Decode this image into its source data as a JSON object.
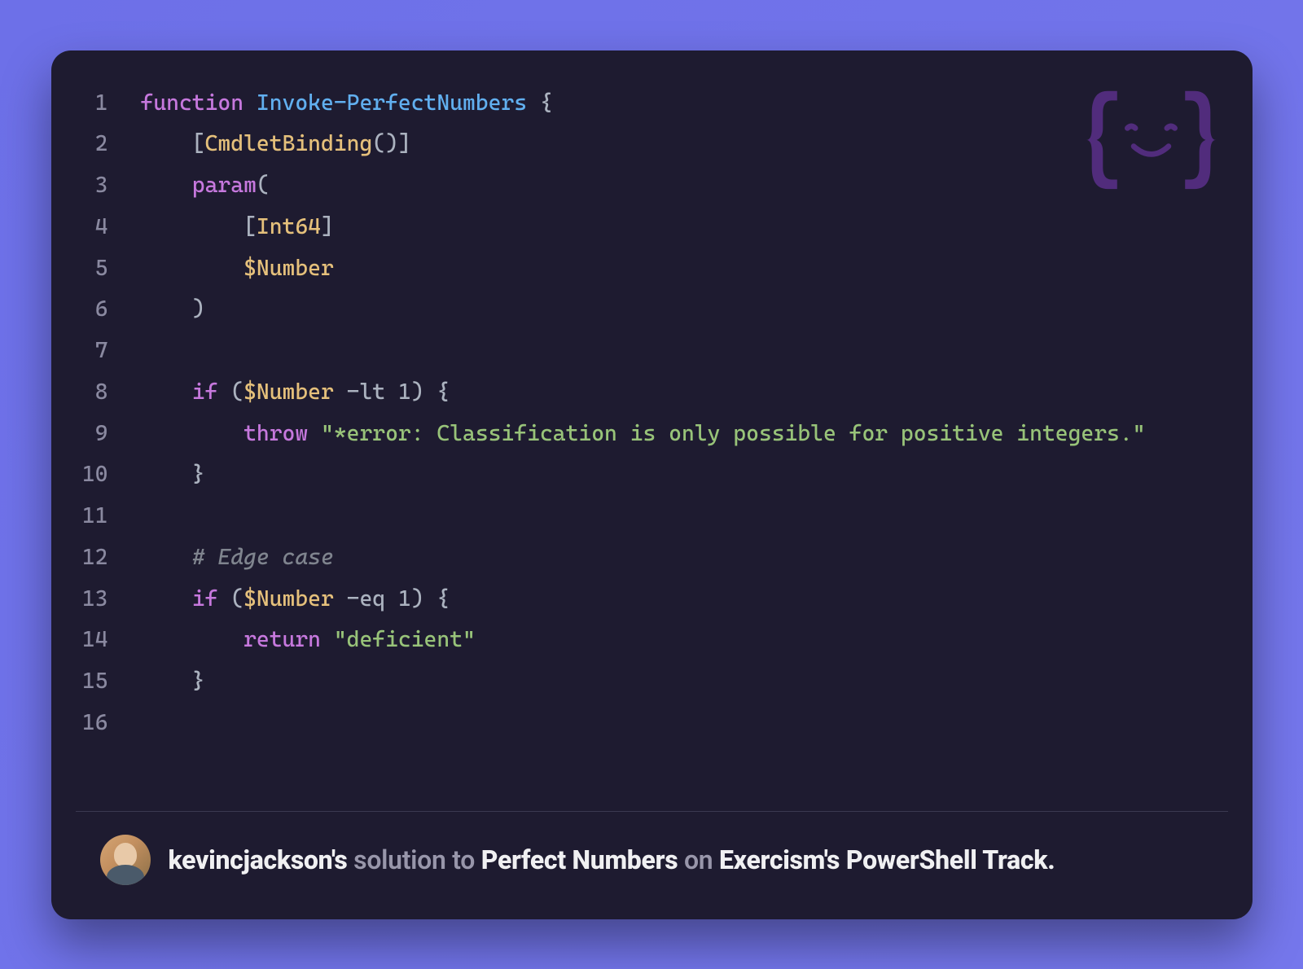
{
  "code": {
    "lines": [
      {
        "n": "1",
        "tokens": [
          {
            "t": "function",
            "c": "keyword"
          },
          {
            "t": " ",
            "c": "plain"
          },
          {
            "t": "Invoke-PerfectNumbers",
            "c": "func"
          },
          {
            "t": " {",
            "c": "punct"
          }
        ]
      },
      {
        "n": "2",
        "tokens": [
          {
            "t": "    [",
            "c": "punct"
          },
          {
            "t": "CmdletBinding",
            "c": "type"
          },
          {
            "t": "()]",
            "c": "punct"
          }
        ]
      },
      {
        "n": "3",
        "tokens": [
          {
            "t": "    ",
            "c": "plain"
          },
          {
            "t": "param",
            "c": "keyword"
          },
          {
            "t": "(",
            "c": "plain"
          }
        ]
      },
      {
        "n": "4",
        "tokens": [
          {
            "t": "        [",
            "c": "punct"
          },
          {
            "t": "Int64",
            "c": "type"
          },
          {
            "t": "]",
            "c": "punct"
          }
        ]
      },
      {
        "n": "5",
        "tokens": [
          {
            "t": "        ",
            "c": "plain"
          },
          {
            "t": "$Number",
            "c": "var"
          }
        ]
      },
      {
        "n": "6",
        "tokens": [
          {
            "t": "    )",
            "c": "plain"
          }
        ]
      },
      {
        "n": "7",
        "tokens": []
      },
      {
        "n": "8",
        "tokens": [
          {
            "t": "    ",
            "c": "plain"
          },
          {
            "t": "if",
            "c": "keyword"
          },
          {
            "t": " (",
            "c": "plain"
          },
          {
            "t": "$Number",
            "c": "var"
          },
          {
            "t": " ",
            "c": "plain"
          },
          {
            "t": "-lt",
            "c": "plain"
          },
          {
            "t": " ",
            "c": "plain"
          },
          {
            "t": "1",
            "c": "num"
          },
          {
            "t": ") {",
            "c": "plain"
          }
        ]
      },
      {
        "n": "9",
        "tokens": [
          {
            "t": "        ",
            "c": "plain"
          },
          {
            "t": "throw",
            "c": "keyword"
          },
          {
            "t": " ",
            "c": "plain"
          },
          {
            "t": "\"*error: Classification is only possible for positive integers.\"",
            "c": "string"
          }
        ]
      },
      {
        "n": "10",
        "tokens": [
          {
            "t": "    }",
            "c": "plain"
          }
        ]
      },
      {
        "n": "11",
        "tokens": []
      },
      {
        "n": "12",
        "tokens": [
          {
            "t": "    ",
            "c": "plain"
          },
          {
            "t": "# Edge case",
            "c": "comment"
          }
        ]
      },
      {
        "n": "13",
        "tokens": [
          {
            "t": "    ",
            "c": "plain"
          },
          {
            "t": "if",
            "c": "keyword"
          },
          {
            "t": " (",
            "c": "plain"
          },
          {
            "t": "$Number",
            "c": "var"
          },
          {
            "t": " ",
            "c": "plain"
          },
          {
            "t": "-eq",
            "c": "plain"
          },
          {
            "t": " ",
            "c": "plain"
          },
          {
            "t": "1",
            "c": "num"
          },
          {
            "t": ") {",
            "c": "plain"
          }
        ]
      },
      {
        "n": "14",
        "tokens": [
          {
            "t": "        ",
            "c": "plain"
          },
          {
            "t": "return",
            "c": "keyword"
          },
          {
            "t": " ",
            "c": "plain"
          },
          {
            "t": "\"deficient\"",
            "c": "string"
          }
        ]
      },
      {
        "n": "15",
        "tokens": [
          {
            "t": "    }",
            "c": "plain"
          }
        ]
      },
      {
        "n": "16",
        "tokens": []
      }
    ]
  },
  "footer": {
    "username": "kevincjackson's",
    "solution_to": " solution to ",
    "exercise": "Perfect Numbers",
    "on": " on ",
    "site": "Exercism's",
    "track": " PowerShell Track."
  }
}
